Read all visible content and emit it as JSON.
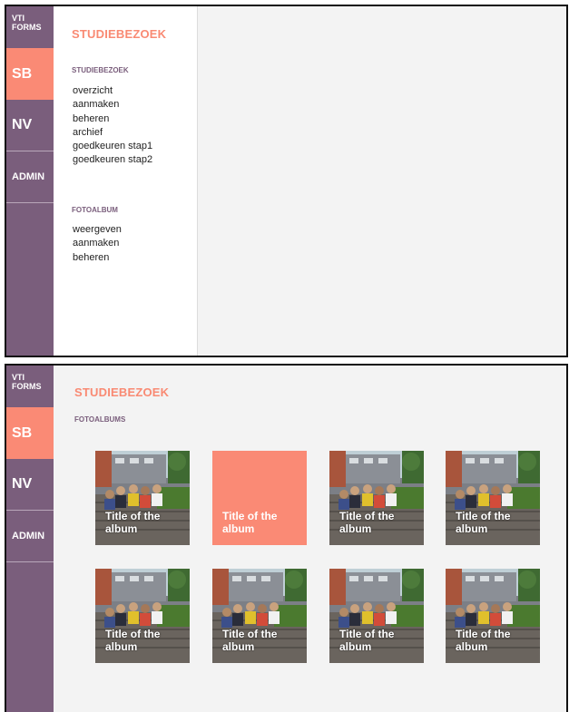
{
  "colors": {
    "sidebar": "#7a5e7c",
    "accent": "#fa8a75",
    "background": "#f3f3f3"
  },
  "brand": {
    "line1": "VTI",
    "line2": "FORMS"
  },
  "nav": [
    {
      "label": "SB",
      "active": true
    },
    {
      "label": "NV",
      "active": false
    },
    {
      "label": "ADMIN",
      "active": false
    }
  ],
  "app_title": "STUDIEBEZOEK",
  "menu": {
    "studiebezoek_heading": "STUDIEBEZOEK",
    "studiebezoek_items": [
      "overzicht",
      "aanmaken",
      "beheren",
      "archief",
      "goedkeuren stap1",
      "goedkeuren stap2"
    ],
    "fotoalbum_heading": "FOTOALBUM",
    "fotoalbum_items": [
      "weergeven",
      "aanmaken",
      "beheren"
    ]
  },
  "albums_view": {
    "heading": "FOTOALBUMS",
    "albums": [
      {
        "title": "Title of the album",
        "has_photo": true
      },
      {
        "title": "Title of the album",
        "has_photo": false
      },
      {
        "title": "Title of the album",
        "has_photo": true
      },
      {
        "title": "Title of the album",
        "has_photo": true
      },
      {
        "title": "Title of the album",
        "has_photo": true
      },
      {
        "title": "Title of the album",
        "has_photo": true
      },
      {
        "title": "Title of the album",
        "has_photo": true
      },
      {
        "title": "Title of the album",
        "has_photo": true
      }
    ]
  }
}
